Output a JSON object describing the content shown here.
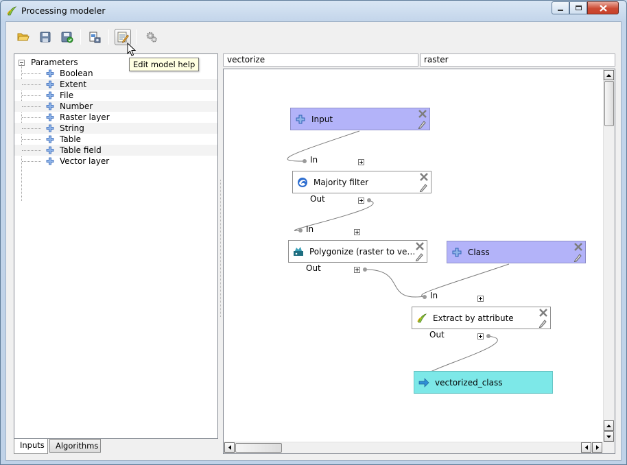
{
  "window": {
    "title": "Processing modeler",
    "controls": {
      "minimize": "minimize",
      "maximize": "maximize",
      "close": "close"
    }
  },
  "toolbar": {
    "buttons": [
      {
        "name": "open-model",
        "icon": "folder-open-icon"
      },
      {
        "name": "save-model",
        "icon": "floppy-icon"
      },
      {
        "name": "save-model-as",
        "icon": "floppy-check-icon"
      },
      {
        "name": "export-image",
        "icon": "export-image-icon"
      },
      {
        "name": "edit-model-help",
        "icon": "edit-help-icon",
        "active": true
      },
      {
        "name": "run-model",
        "icon": "gears-icon"
      }
    ],
    "tooltip": "Edit model help"
  },
  "left_panel": {
    "root_label": "Parameters",
    "items": [
      "Boolean",
      "Extent",
      "File",
      "Number",
      "Raster layer",
      "String",
      "Table",
      "Table field",
      "Vector layer"
    ],
    "tabs": [
      "Inputs",
      "Algorithms"
    ],
    "active_tab": "Inputs"
  },
  "model": {
    "name_value": "vectorize",
    "group_value": "raster"
  },
  "canvas": {
    "nodes": {
      "input": {
        "label": "Input",
        "kind": "parameter"
      },
      "majority": {
        "label": "Majority filter",
        "kind": "algorithm",
        "in_label": "In",
        "out_label": "Out"
      },
      "polygonize": {
        "label": "Polygonize (raster to vect...",
        "kind": "algorithm",
        "in_label": "In",
        "out_label": "Out"
      },
      "class": {
        "label": "Class",
        "kind": "parameter"
      },
      "extract": {
        "label": "Extract by attribute",
        "kind": "algorithm",
        "in_label": "In",
        "out_label": "Out"
      },
      "output": {
        "label": "vectorized_class",
        "kind": "output"
      }
    }
  },
  "colors": {
    "parameter_node": "#b3b3f9",
    "output_node": "#7de8e8",
    "link": "#7a7a7a"
  }
}
